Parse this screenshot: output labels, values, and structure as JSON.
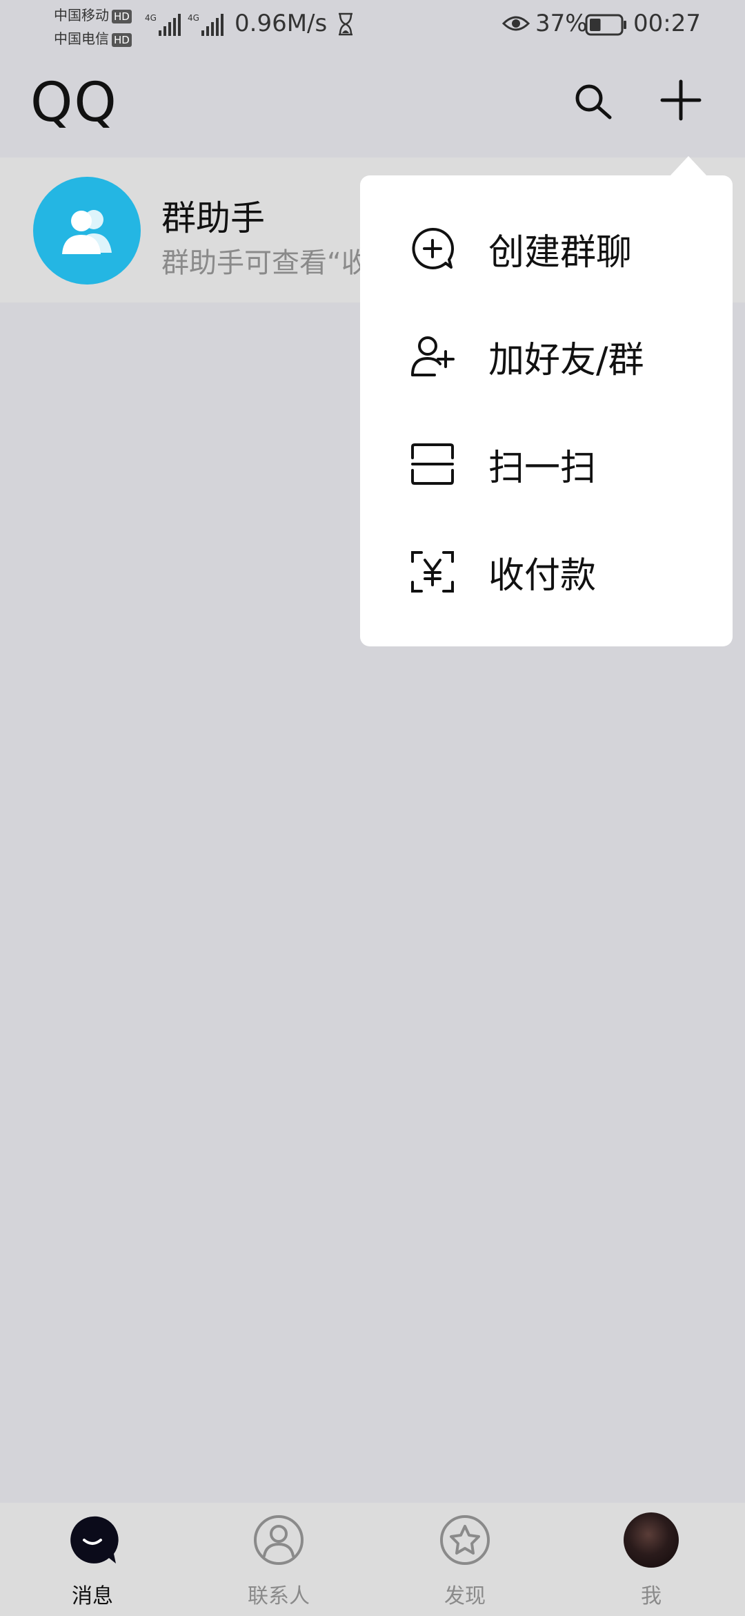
{
  "status_bar": {
    "carrier_1": "中国移动",
    "carrier_2": "中国电信",
    "hd_badge": "HD",
    "network_type": "4G",
    "net_speed": "0.96M/s",
    "battery_percent": "37%",
    "battery_level": 0.37,
    "time": "00:27"
  },
  "header": {
    "title": "QQ",
    "search_icon": "search-icon",
    "add_icon": "plus-icon"
  },
  "conversation": {
    "title": "群助手",
    "preview": "群助手可查看“收",
    "avatar_icon": "group-people-icon"
  },
  "popup_menu": {
    "items": [
      {
        "label": "创建群聊",
        "icon": "create-group-chat-icon"
      },
      {
        "label": "加好友/群",
        "icon": "add-friend-icon"
      },
      {
        "label": "扫一扫",
        "icon": "scan-icon"
      },
      {
        "label": "收付款",
        "icon": "payment-icon"
      }
    ]
  },
  "bottom_nav": {
    "items": [
      {
        "label": "消息",
        "icon": "message-icon",
        "active": true
      },
      {
        "label": "联系人",
        "icon": "contacts-icon",
        "active": false
      },
      {
        "label": "发现",
        "icon": "discover-star-icon",
        "active": false
      },
      {
        "label": "我",
        "icon": "avatar",
        "active": false
      }
    ]
  },
  "colors": {
    "background": "#d4d4d9",
    "accent_avatar": "#24b6e3",
    "menu_background": "#ffffff",
    "text_primary": "#111111",
    "text_secondary": "#8a8a8a"
  }
}
